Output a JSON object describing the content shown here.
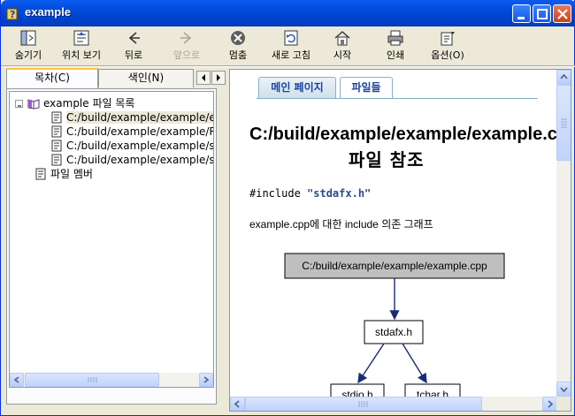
{
  "window": {
    "title": "example"
  },
  "toolbar": {
    "hide": "숨기기",
    "locate": "위치 보기",
    "back": "뒤로",
    "forward": "앞으로",
    "stop": "멈춤",
    "refresh": "새로 고침",
    "home": "시작",
    "print": "인쇄",
    "options": "옵션(O)"
  },
  "left": {
    "tabs": [
      "목차(C)",
      "색인(N)"
    ],
    "tree": {
      "root": "example 파일 목록",
      "items": [
        "C:/build/example/example/example.cpp",
        "C:/build/example/example/ReadMe.txt",
        "C:/build/example/example/stdafx.cpp",
        "C:/build/example/example/stdafx.h"
      ],
      "members": "파일 멤버"
    }
  },
  "content": {
    "tabs": [
      "메인 페이지",
      "파일들"
    ],
    "heading": "C:/build/example/example/example.cpp",
    "heading_sub": "파일 참조",
    "include_prefix": "#include ",
    "include_file": "\"stdafx.h\"",
    "dependency_text": "example.cpp에 대한 include 의존 그래프",
    "graph": {
      "root": "C:/build/example/example/example.cpp",
      "mid": "stdafx.h",
      "leaves": [
        "stdio.h",
        "tchar.h"
      ]
    }
  }
}
